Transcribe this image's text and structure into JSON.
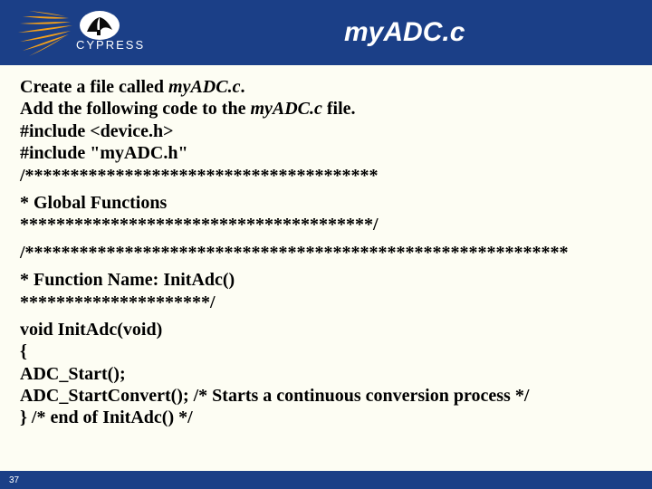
{
  "header": {
    "brand_text": "CYPRESS",
    "title": "myADC.c"
  },
  "content": {
    "line1a": "Create a file called ",
    "line1b": "myADC.c",
    "line1c": ".",
    "line2a": "Add the following code to the ",
    "line2b": "myADC.c",
    "line2c": " file.",
    "line3": "#include <device.h>",
    "line4": "#include \"myADC.h\"",
    "line5": "/***************************************",
    "line6": "* Global Functions",
    "line7": "***************************************/",
    "line8": "/************************************************************",
    "line9": "* Function Name: InitAdc()",
    "line10": "*********************/",
    "line11": "void InitAdc(void)",
    "line12": "{",
    "line13": "ADC_Start();",
    "line14": "ADC_StartConvert(); /* Starts a continuous conversion process */",
    "line15": "} /* end of InitAdc() */"
  },
  "footer": {
    "page_number": "37"
  }
}
